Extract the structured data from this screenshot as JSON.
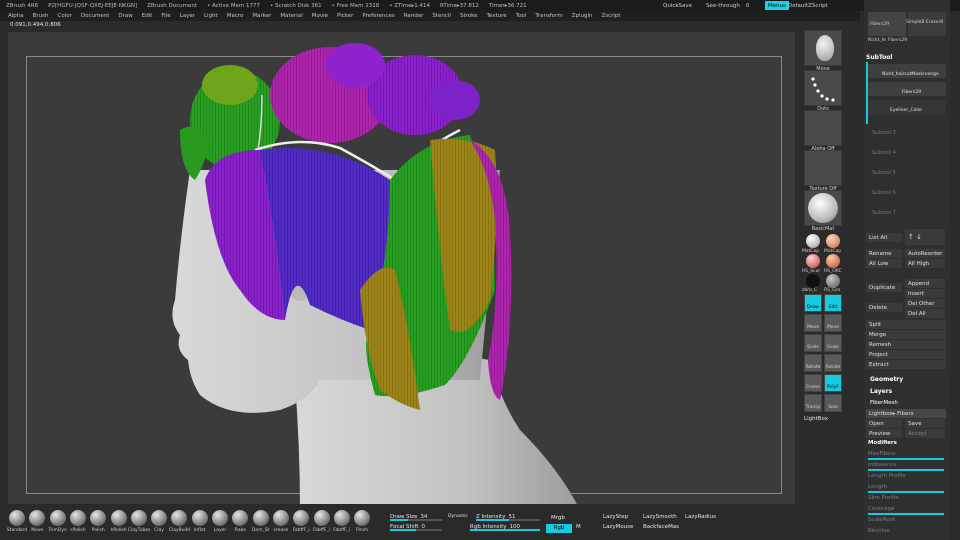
{
  "titlebar": {
    "app": "ZBrush 4R6",
    "serial": "P2[HGFU-JQSF-QXEJ-EEJE-NKGN]",
    "document": "ZBrush Document",
    "active_mem": "• Active Mem 1777",
    "scratch_disk": "• Scratch Disk 361",
    "free_mem": "• Free Mem 2318",
    "ztime": "• ZTime▸1.414",
    "rtime": "RTime▸37.812",
    "timer": "Timer▸36.721",
    "quicksave": "QuickSave",
    "see_through": "See-through",
    "see_through_value": "0",
    "menus": "Menus",
    "default_zscript": "DefaultZScript"
  },
  "menubar": [
    "Alpha",
    "Brush",
    "Color",
    "Document",
    "Draw",
    "Edit",
    "File",
    "Layer",
    "Light",
    "Macro",
    "Marker",
    "Material",
    "Movie",
    "Picker",
    "Preferences",
    "Render",
    "Stencil",
    "Stroke",
    "Texture",
    "Tool",
    "Transform",
    "Zplugin",
    "Zscript"
  ],
  "coords": "0.091,0.494,0.806",
  "shelf": {
    "move": "Move",
    "dots": "Dots",
    "alpha_off": "Alpha Off",
    "texture_off": "Texture Off",
    "mat_label": "BasicMat",
    "mats": [
      "MatCap",
      "MatCap",
      "RS_Scul",
      "RS_ORC",
      "zbro_C",
      "RS_Gre"
    ],
    "draw": "Draw",
    "edit": "Edit",
    "move_btn": "Move",
    "scale_btn": "Scale",
    "rotate_btn": "Rotate",
    "frame": "Frame",
    "polyf": "PolyF",
    "transp": "Transp",
    "solo": "Solo",
    "lightbox": "LightBox",
    "move2": "Move",
    "scale2": "Scale",
    "rotate2": "Rotate"
  },
  "palette": {
    "fibers_thumb": "Fibers29",
    "simple_eraser": "SimpleB EraserB",
    "nickt": "Nickt_fe",
    "fibers2": "Fibers29",
    "subtool": "SubTool",
    "subtools": [
      "Nickt_haircutMaskrvenge",
      "Fibers29",
      "Eyeliner_Color"
    ],
    "subtool_slots": [
      "Subtool 3",
      "Subtool 4",
      "Subtool 5",
      "Subtool 6",
      "Subtool 7"
    ],
    "list_all": "List All",
    "rename": "Rename",
    "auto_reorder": "AutoReorder",
    "all_low": "All Low",
    "all_high": "All High",
    "duplicate": "Duplicate",
    "append": "Append",
    "insert": "Insert",
    "delete": "Delete",
    "del_other": "Del Other",
    "del_all": "Del All",
    "split": "Split",
    "merge": "Merge",
    "remesh": "Remesh",
    "project": "Project",
    "extract": "Extract",
    "geometry": "Geometry",
    "layers": "Layers",
    "fibermesh": "FiberMesh",
    "lightbox_fibers": "Lightbox▸ Fibers",
    "open": "Open",
    "save": "Save",
    "preview": "Preview",
    "accept": "Accept",
    "modifiers": "Modifiers",
    "dim_rows": [
      "MaxFibers",
      "Imbalance",
      "Length Profile",
      "Length",
      "Slim Profile",
      "Coverage",
      "ScaleRoot",
      "Revolve"
    ]
  },
  "brushes": [
    "Standard",
    "Move",
    "TrimDyn",
    "sPolish",
    "Polish",
    "hPolish",
    "ClayTubes",
    "Clay",
    "ClayBuild",
    "Inflat",
    "Layer",
    "Rake",
    "Dam_St",
    "crease",
    "FabffF_i",
    "FabffF_i",
    "FabffF_i",
    "Pinch"
  ],
  "bottombar": {
    "draw_size": "Draw Size",
    "draw_size_value": "34",
    "dynamic": "Dynamic",
    "z_intensity": "Z Intensity",
    "z_intensity_value": "51",
    "focal_shift": "Focal Shift",
    "focal_shift_value": "0",
    "rgb_intensity": "Rgb  Intensity",
    "rgb_intensity_value": "100",
    "mrgb": "Mrgb",
    "rgb": "Rgb",
    "m": "M",
    "zsub": "Zsub",
    "lazy_step": "LazyStep",
    "lazy_smooth": "LazySmooth",
    "lazy_radius": "LazyRadius",
    "lazy_mouse": "LazyMouse",
    "backface_mask": "BackfaceMas"
  }
}
